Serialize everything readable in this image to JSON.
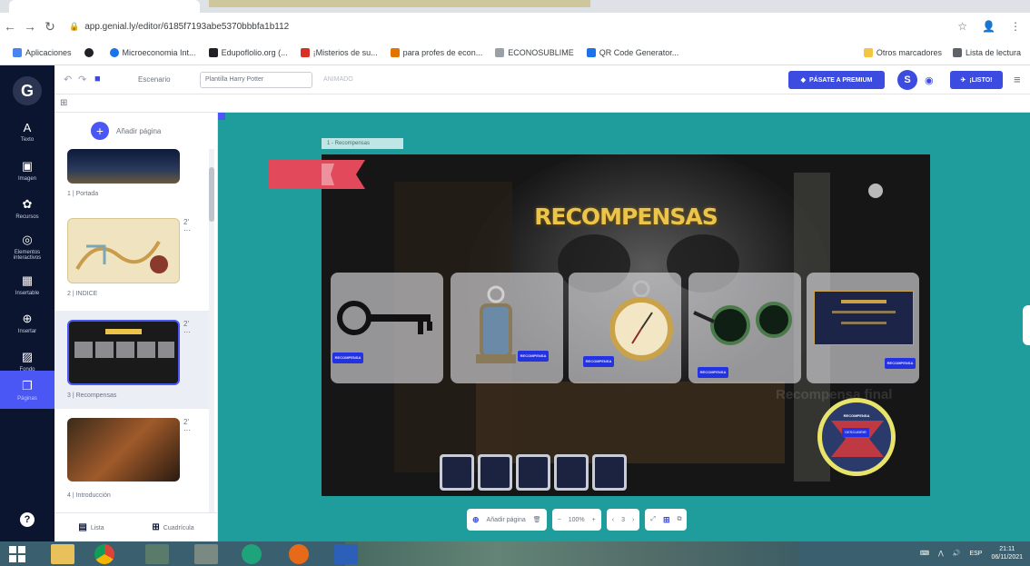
{
  "browser": {
    "url": "app.genial.ly/editor/6185f7193abe5370bbbfa1b112",
    "bookmarks": [
      {
        "label": "Aplicaciones",
        "color": "#4a84f0"
      },
      {
        "label": "",
        "color": "#202124"
      },
      {
        "label": "Microeconomia Int...",
        "color": "#1a73e8"
      },
      {
        "label": "Edupoflolio.org (...",
        "color": "#202124"
      },
      {
        "label": "¡Misterios de su...",
        "color": "#d93025"
      },
      {
        "label": "para profes de econ...",
        "color": "#e37400"
      },
      {
        "label": "ECONOSUBLIME",
        "color": "#9aa0a6"
      },
      {
        "label": "QR Code Generator...",
        "color": "#1a73e8"
      }
    ],
    "bookmarks_right": [
      "Otros marcadores",
      "Lista de lectura"
    ]
  },
  "app": {
    "rail": [
      {
        "label": "Texto",
        "glyph": "A"
      },
      {
        "label": "Imagen",
        "glyph": "▣"
      },
      {
        "label": "Recursos",
        "glyph": "✿"
      },
      {
        "label": "Elementos interactivos",
        "glyph": "◎"
      },
      {
        "label": "Insertable",
        "glyph": "▦"
      },
      {
        "label": "Insertar",
        "glyph": "⊕"
      },
      {
        "label": "Fondo",
        "glyph": "▨"
      },
      {
        "label": "Páginas",
        "glyph": "❐"
      }
    ],
    "toolbar": {
      "doc_title": "Escenario",
      "template_field": "Plantilla Harry Potter",
      "small_field": "ANIMADO",
      "premium_label": "PÁSATE A PREMIUM",
      "listo_label": "¡LISTO!",
      "avatar_letter": "S"
    },
    "pages_panel": {
      "add_page": "Añadir página",
      "pages": [
        {
          "label": "1 | Portada"
        },
        {
          "label": "2 | INDICE"
        },
        {
          "label": "3 | Recompensas"
        },
        {
          "label": "4 | Introducción"
        }
      ],
      "view_list": "Lista",
      "view_grid": "Cuadrícula"
    },
    "slide": {
      "chip": "1 - Recompensas",
      "title": "RECOMPENSAS",
      "card_tag": "RECOMPENSA",
      "faint_text": "Recompensa final",
      "badge_label": "RECOMPENSA",
      "badge_sub": "DESCUBRIR"
    },
    "canvas_controls": {
      "add_page": "Añadir página",
      "zoom": "100%",
      "page_indicator": "3"
    }
  },
  "taskbar": {
    "lang": "ESP",
    "time": "21:11",
    "date": "06/11/2021"
  }
}
